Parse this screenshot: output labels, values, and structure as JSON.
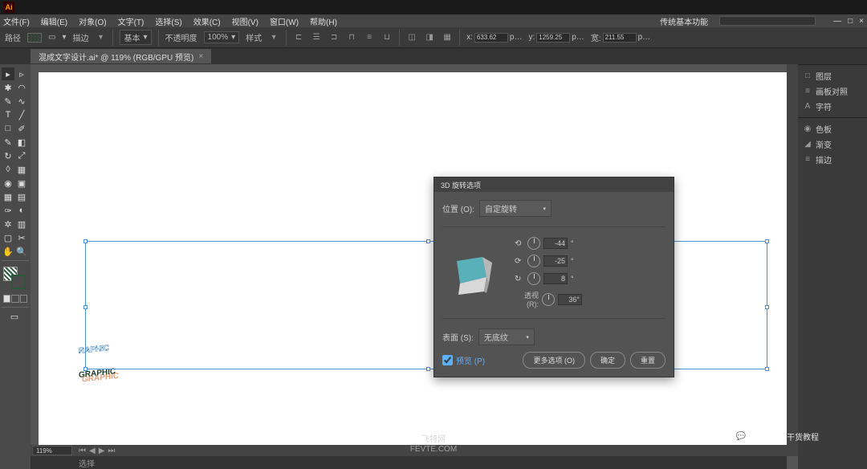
{
  "app": {
    "logo": "Ai",
    "title": "传统基本功能"
  },
  "menu": {
    "items": [
      "文件(F)",
      "编辑(E)",
      "对象(O)",
      "文字(T)",
      "选择(S)",
      "效果(C)",
      "视图(V)",
      "窗口(W)",
      "帮助(H)"
    ]
  },
  "control": {
    "label_path": "路径",
    "stroke_label": "描边",
    "stroke_dd": "基本",
    "opacity_label": "不透明度",
    "opacity_value": "100%",
    "style_label": "样式",
    "x_label": "x:",
    "x_value": "633.62",
    "y_label": "y:",
    "y_value": "1259.25",
    "w_label": "宽:",
    "w_value": "211.55",
    "unit": "p…"
  },
  "document": {
    "tab": "混成文字设计.ai* @ 119% (RGB/GPU 预览)",
    "close": "×"
  },
  "right_panels": {
    "group1": [
      {
        "icon": "□",
        "label": "图层"
      },
      {
        "icon": "≡",
        "label": "画板对照"
      },
      {
        "icon": "A",
        "label": "字符"
      }
    ],
    "group2": [
      {
        "icon": "◉",
        "label": "色板"
      },
      {
        "icon": "◢",
        "label": "渐变"
      },
      {
        "icon": "≡",
        "label": "描边"
      }
    ]
  },
  "status": {
    "zoom": "119%",
    "selection": "选择",
    "blank": ""
  },
  "dialog": {
    "title": "3D 旋转选项",
    "position_label": "位置 (O):",
    "position_dd": "自定旋转",
    "axis_x": "-44",
    "axis_y": "-25",
    "axis_z": "8",
    "perspective_label": "透视 (R):",
    "perspective_value": "36°",
    "surface_label": "表面 (S):",
    "surface_dd": "无底纹",
    "preview_label": "预览 (P)",
    "btn_more": "更多选项 (O)",
    "btn_ok": "确定",
    "btn_reset": "重置"
  },
  "canvas_text": "GRAPHIC",
  "watermarks": {
    "center1": "飞特网",
    "center2": "FEVTE.COM",
    "right": "平面设计干货教程"
  }
}
